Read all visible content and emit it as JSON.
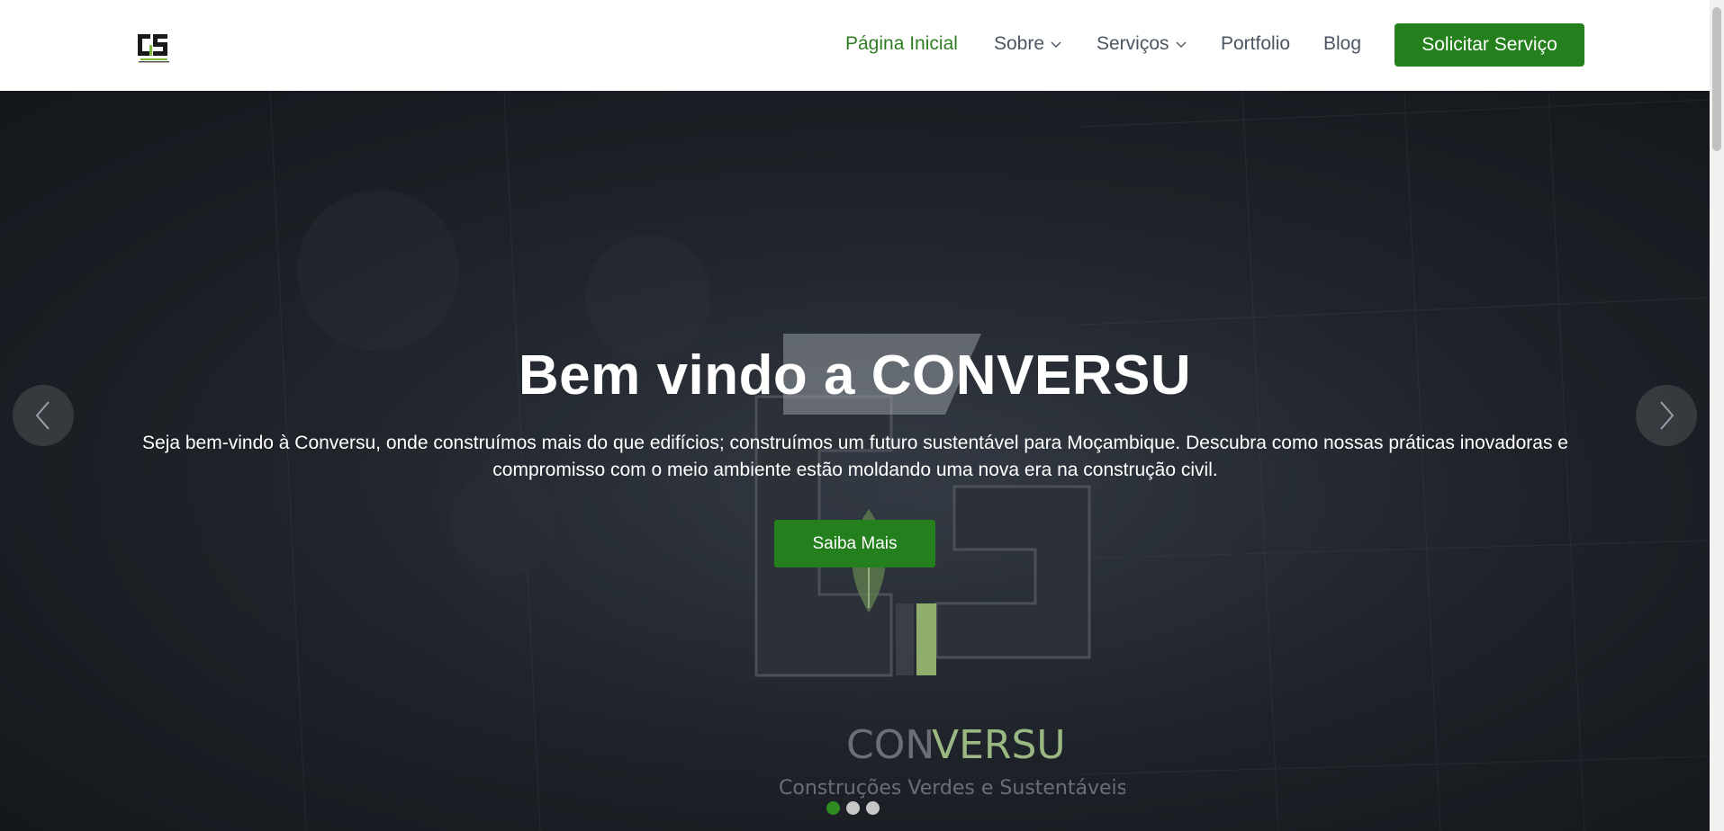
{
  "header": {
    "logo_icon": "conversu-logo-icon",
    "nav": [
      {
        "label": "Página Inicial",
        "active": true,
        "dropdown": false
      },
      {
        "label": "Sobre",
        "active": false,
        "dropdown": true
      },
      {
        "label": "Serviços",
        "active": false,
        "dropdown": true
      },
      {
        "label": "Portfolio",
        "active": false,
        "dropdown": false
      },
      {
        "label": "Blog",
        "active": false,
        "dropdown": false
      }
    ],
    "cta_label": "Solicitar Serviço"
  },
  "hero": {
    "title": "Bem vindo a CONVERSU",
    "text_line1": "Seja bem-vindo à Conversu, onde construímos mais do que edifícios; construímos um futuro sustentável para Moçambique. Descubra como nossas práticas inovadoras e",
    "text_line2": "compromisso com o meio ambiente estão moldando uma nova era na construção civil.",
    "button_label": "Saiba Mais",
    "brand_name_a": "CON",
    "brand_name_b": "VERSU",
    "brand_tagline": "Construções Verdes e Sustentáveis",
    "slides_total": 3,
    "slide_active": 1
  },
  "colors": {
    "accent": "#24801c",
    "nav_active": "#2e7d23",
    "nav_text": "#4b5563",
    "hero_bg": "#262b33"
  }
}
